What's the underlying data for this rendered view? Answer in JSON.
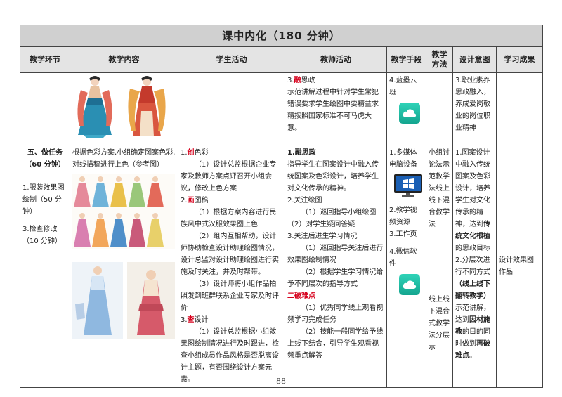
{
  "title": "课中内化（180 分钟）",
  "headers": [
    "教学环节",
    "教学内容",
    "学生活动",
    "教师活动",
    "教学手段",
    "教学方法",
    "设计意图",
    "学习成果"
  ],
  "row1": {
    "teacher": {
      "num": "3.",
      "key": "融",
      "rest": "思政",
      "body": "示范讲解过程中针对学生常犯错误要求学生绘图中要精益求精按照国家标准不可马虎大意。"
    },
    "means": "4.蓝墨云班",
    "intent": "3.职业素养思政融入，养成爱岗敬业的岗位职业精神"
  },
  "row2": {
    "phase_title": "五、做任务（60 分钟）",
    "phase_item1": "1.服装效果图绘制（50 分钟）",
    "phase_item2": "3.检查修改（10 分钟）",
    "content": "根据色彩方案,小组确定图案色彩,对线描稿进行上色（参考图）",
    "student": {
      "s1_num": "1.",
      "s1_key": "创",
      "s1_rest": "色彩",
      "s1_p1": "（1）设计总监根据企业专家及教师方案点评召开小组会议，修改上色方案",
      "s2_num": "2.",
      "s2_key": "画",
      "s2_rest": "图稿",
      "s2_p1": "（1）根据方案内容进行民族风中式汉服效果图上色",
      "s2_p2": "（2）组内互相帮助，设计师协助检查设计助理绘图情况，设计总监对设计助理绘图进行实施及时关注，并及时帮带。",
      "s2_p3": "（3）设计师将小组作品拍照发到班群联系企业专家及时评价",
      "s3_num": "3.",
      "s3_key": "查",
      "s3_rest": "设计",
      "s3_p1": "（1）设计总监根据小组效果图绘制情况进行及时跟进，检查小组成员作品风格是否脱离设计主题，有否围绕设计方案元素。"
    },
    "teacher": {
      "t1": "1.融思政",
      "t1_body": "指导学生在图案设计中融入传统图案及色彩设计，培养学生对文化传承的精神。",
      "t2": "2.关注绘图",
      "t2_p1": "（1）巡回指导小组绘图（2）对学生疑问答疑",
      "t3": "3.关注后进生学习情况",
      "t3_p1": "（1）巡回指导关注后进行效果图绘制情况",
      "t3_p2": "（2）根据学生学习情况给予不同层次的指导方式",
      "t4": "二破难点",
      "t4_p1": "（1）优秀同学线上观看视频学习完成任务",
      "t4_p2": "（2）技能一般同学给予线上线下结合，引导学生观看视频重点解答"
    },
    "means": {
      "m1": "1.多媒体电脑设备",
      "m2": "2.教学视频资源",
      "m3": "3.工作页",
      "m4": "4.微信软件"
    },
    "method1": "小组讨论法示范教学法线上线下混合教学法",
    "method2": "线上线下混合式教学法分层示",
    "intent": {
      "i1_a": "1.图案设计中融入传统图案及色彩设计，培养学生对文化传承的精神，达到",
      "i1_b": "传统文化根植",
      "i1_c": "的思政目标",
      "i2_a": "2.分层次进行不同方式",
      "i2_b": "（线上线下翻转教学）",
      "i2_c": "示范讲解，达到",
      "i2_d": "因材施教",
      "i2_e": "的目的同时做到",
      "i2_f": "再破难点",
      "i2_g": "。"
    },
    "outcome": "设计效果图作品"
  },
  "page_number": "88",
  "colors": {
    "accent_red": "#d6001c",
    "header_gray": "#d0d0d0",
    "icon_teal": "#1fbfa3"
  },
  "icons": [
    "cloud-class-icon",
    "monitor-icon",
    "wechat-cloud-icon"
  ]
}
